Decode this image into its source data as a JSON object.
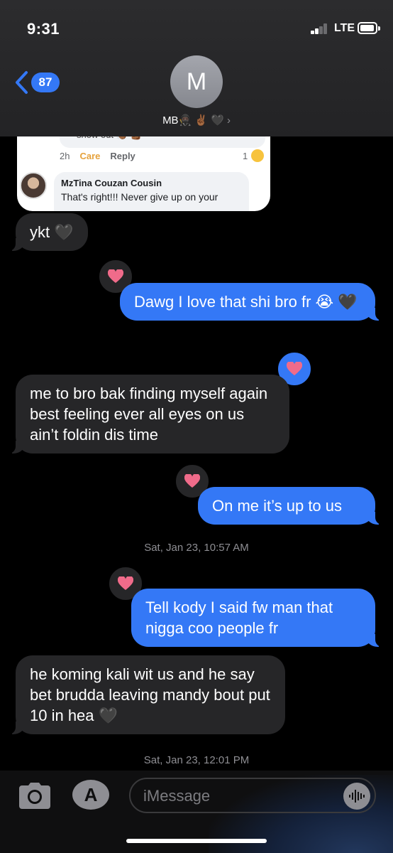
{
  "status_bar": {
    "time": "9:31",
    "network": "LTE"
  },
  "header": {
    "back_count": "87",
    "avatar_initial": "M",
    "contact_name": "MB🥷🏿 ✌🏾 🖤",
    "chevron": "›"
  },
  "screenshot_card": {
    "top_text": "show out 👏🏾 💪🏾",
    "time": "2h",
    "care": "Care",
    "reply": "Reply",
    "reaction_count": "1",
    "author": "MzTina Couzan Cousin",
    "comment": "That's right!!! Never give up on your"
  },
  "messages": [
    {
      "type": "received",
      "text": "ykt 🖤"
    },
    {
      "type": "sent",
      "text": "Dawg I love that shi bro fr 😭 🖤",
      "tapback": "heart"
    },
    {
      "type": "received",
      "text": "me to bro bak finding myself again best feeling ever all eyes on us ain’t foldin dis time",
      "tapback": "heart"
    },
    {
      "type": "sent",
      "text": "On me it’s up to us",
      "tapback": "heart"
    },
    {
      "type": "sent",
      "text": "Tell kody I said fw man that nigga coo people fr",
      "tapback": "heart"
    },
    {
      "type": "received",
      "text": "he koming kali wit us and he say bet brudda leaving mandy bout put 10 in hea 🖤"
    }
  ],
  "timestamps": [
    "Sat, Jan 23, 10:57 AM",
    "Sat, Jan 23, 12:01 PM"
  ],
  "input": {
    "placeholder": "iMessage"
  },
  "colors": {
    "sent": "#3478f6",
    "received": "#262628",
    "tapback_heart": "#f06b8a"
  }
}
